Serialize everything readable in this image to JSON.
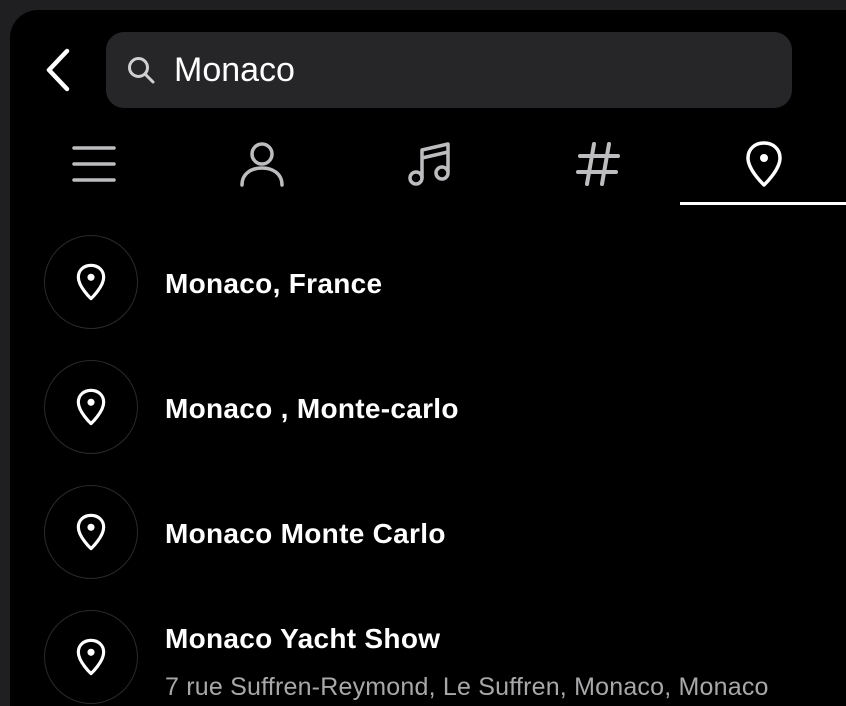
{
  "search": {
    "query": "Monaco"
  },
  "tabs": [
    {
      "id": "top",
      "icon": "menu-icon",
      "active": false
    },
    {
      "id": "accounts",
      "icon": "person-icon",
      "active": false
    },
    {
      "id": "audio",
      "icon": "music-note-icon",
      "active": false
    },
    {
      "id": "tags",
      "icon": "hashtag-icon",
      "active": false
    },
    {
      "id": "places",
      "icon": "location-pin-icon",
      "active": true
    }
  ],
  "results": [
    {
      "title": "Monaco, France",
      "subtitle": ""
    },
    {
      "title": "Monaco , Monte-carlo",
      "subtitle": ""
    },
    {
      "title": "Monaco Monte Carlo",
      "subtitle": ""
    },
    {
      "title": "Monaco Yacht Show",
      "subtitle": "7 rue Suffren-Reymond, Le Suffren, Monaco, Monaco"
    }
  ],
  "colors": {
    "background": "#000000",
    "search_field": "#262628",
    "text_primary": "#ffffff",
    "text_secondary": "#a8a8aa",
    "indicator": "#ffffff"
  }
}
